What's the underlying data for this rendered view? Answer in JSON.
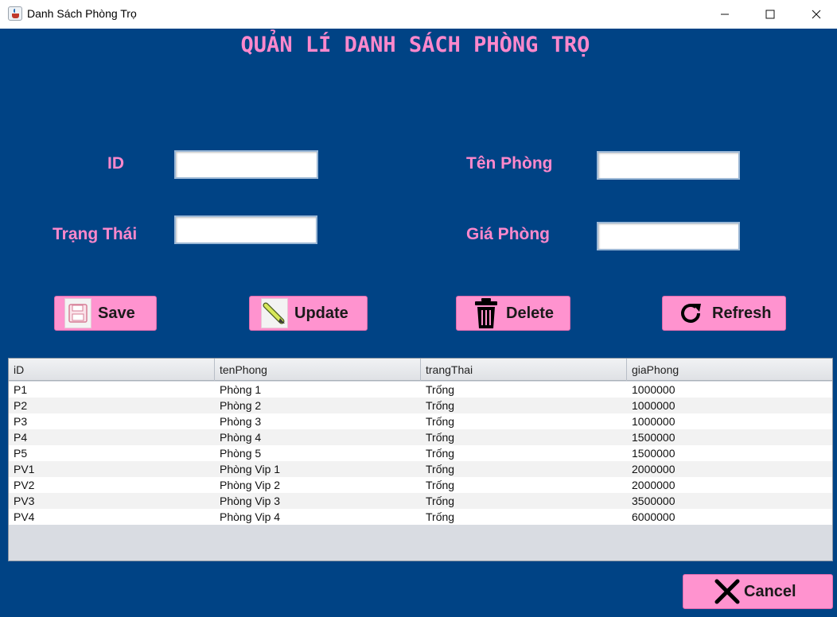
{
  "window": {
    "title": "Danh Sách Phòng Trọ"
  },
  "heading": "QUẢN LÍ DANH SÁCH PHÒNG TRỌ",
  "form": {
    "id_label": "ID",
    "trangthai_label": "Trạng Thái",
    "tenphong_label": "Tên Phòng",
    "giaphong_label": "Giá Phòng",
    "id_value": "",
    "trangthai_value": "",
    "tenphong_value": "",
    "giaphong_value": ""
  },
  "buttons": {
    "save": "Save",
    "update": "Update",
    "delete": "Delete",
    "refresh": "Refresh",
    "cancel": "Cancel"
  },
  "icons": {
    "save": "floppy-disk-icon",
    "update": "pencil-icon",
    "delete": "trash-icon",
    "refresh": "refresh-icon",
    "cancel": "x-icon"
  },
  "colors": {
    "background": "#004385",
    "accent_pink": "#ff88cc",
    "button_pink": "#ff93cf"
  },
  "table": {
    "columns": [
      "iD",
      "tenPhong",
      "trangThai",
      "giaPhong"
    ],
    "rows": [
      [
        "P1",
        "Phòng 1",
        "Trống",
        "1000000"
      ],
      [
        "P2",
        "Phòng 2",
        "Trống",
        "1000000"
      ],
      [
        "P3",
        "Phòng 3",
        "Trống",
        "1000000"
      ],
      [
        "P4",
        "Phòng 4",
        "Trống",
        "1500000"
      ],
      [
        "P5",
        "Phòng 5",
        "Trống",
        "1500000"
      ],
      [
        "PV1",
        "Phòng Vip 1",
        "Trống",
        "2000000"
      ],
      [
        "PV2",
        "Phòng Vip 2",
        "Trống",
        "2000000"
      ],
      [
        "PV3",
        "Phòng Vip 3",
        "Trống",
        "3500000"
      ],
      [
        "PV4",
        "Phòng Vip 4",
        "Trống",
        "6000000"
      ]
    ]
  }
}
